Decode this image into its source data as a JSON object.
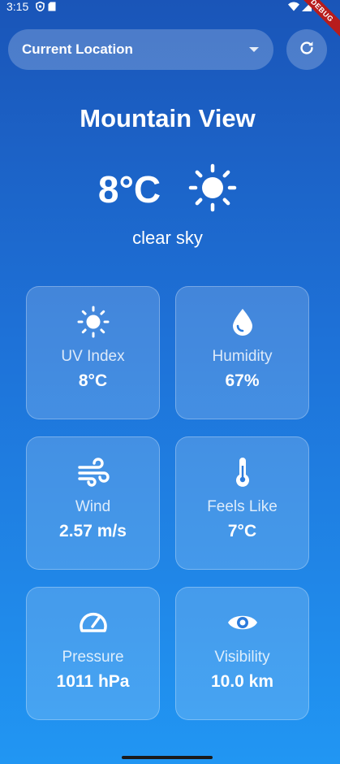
{
  "status_bar": {
    "time": "3:15",
    "debug_label": "DEBUG"
  },
  "header": {
    "location_label": "Current Location",
    "refresh_icon": "refresh-icon"
  },
  "weather": {
    "city": "Mountain View",
    "temperature": "8°C",
    "condition": "clear sky",
    "condition_icon": "sun-icon"
  },
  "cards": [
    {
      "icon": "sun-icon",
      "label": "UV Index",
      "value": "8°C"
    },
    {
      "icon": "water-drop-icon",
      "label": "Humidity",
      "value": "67%"
    },
    {
      "icon": "wind-icon",
      "label": "Wind",
      "value": "2.57 m/s"
    },
    {
      "icon": "thermometer-icon",
      "label": "Feels Like",
      "value": "7°C"
    },
    {
      "icon": "speedometer-icon",
      "label": "Pressure",
      "value": "1011 hPa"
    },
    {
      "icon": "eye-icon",
      "label": "Visibility",
      "value": "10.0 km"
    }
  ],
  "colors": {
    "gradient_top": "#1a55b8",
    "gradient_bottom": "#2196f3",
    "debug_ribbon": "#b71c1c"
  }
}
